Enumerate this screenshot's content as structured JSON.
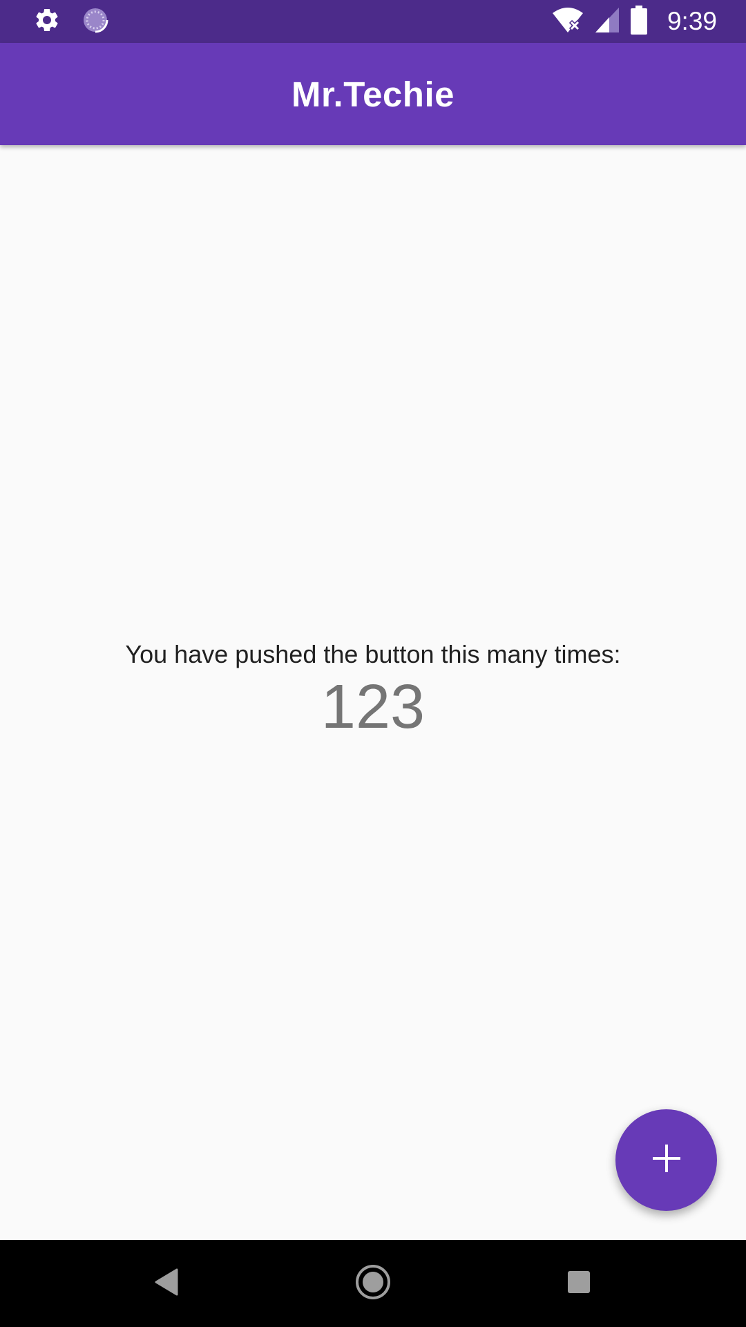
{
  "status_bar": {
    "time": "9:39",
    "icons": [
      "settings-icon",
      "loading-icon",
      "wifi-icon",
      "signal-icon",
      "battery-icon"
    ]
  },
  "app_bar": {
    "title": "Mr.Techie"
  },
  "body": {
    "counter_label": "You have pushed the button this many times:",
    "counter_value": "123"
  },
  "fab": {
    "icon": "plus-icon"
  },
  "nav_bar": {
    "icons": [
      "back-icon",
      "home-icon",
      "recents-icon"
    ]
  },
  "colors": {
    "status_bar": "#4c2b8a",
    "primary": "#673ab7",
    "background": "#fafafa",
    "label_text": "#212121",
    "counter_text": "#757575",
    "nav_bar": "#000000"
  }
}
